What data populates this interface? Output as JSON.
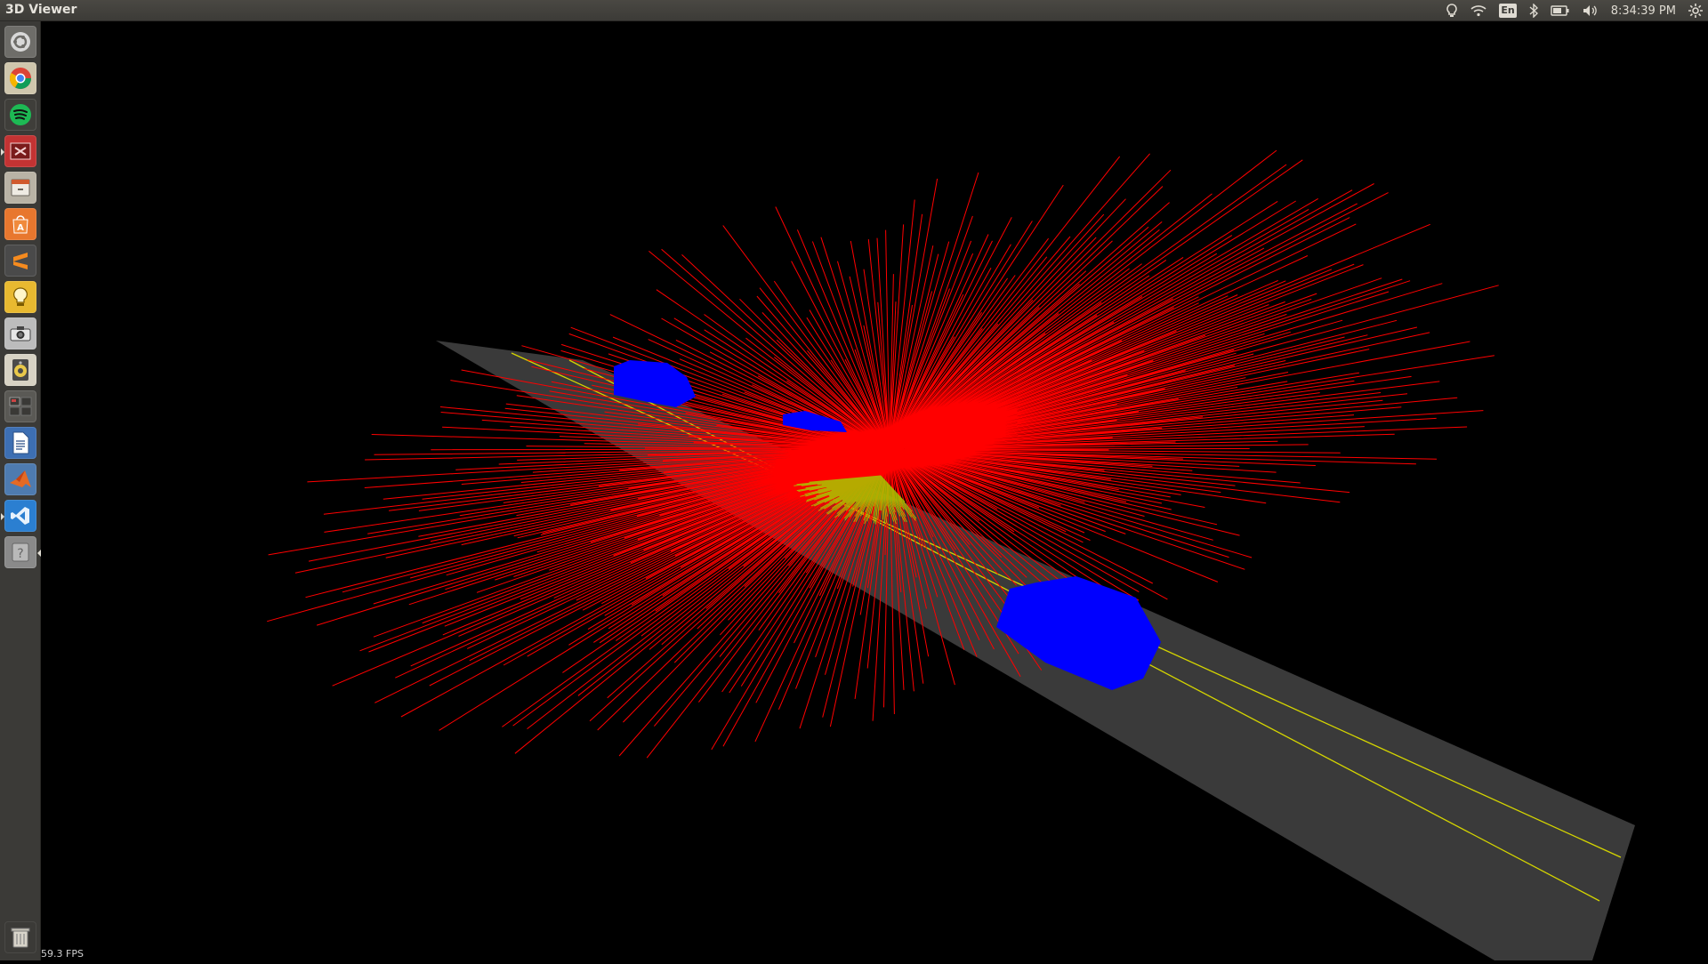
{
  "topbar": {
    "app_title": "3D Viewer",
    "keyboard_layout": "En",
    "clock": "8:34:39 PM",
    "indicators": [
      "notification-bulb-icon",
      "wifi-icon",
      "keyboard-layout-icon",
      "bluetooth-icon",
      "battery-icon",
      "volume-icon",
      "system-gear-icon"
    ]
  },
  "launcher": {
    "items": [
      {
        "name": "dash-home",
        "icon": "ubuntu-logo-icon",
        "color": "#9a9a9a"
      },
      {
        "name": "chrome",
        "icon": "chrome-icon",
        "color": "#d8d0b8"
      },
      {
        "name": "spotify",
        "icon": "spotify-icon",
        "color": "#1db954"
      },
      {
        "name": "terminal-app",
        "icon": "red-app-icon",
        "color": "#c33333"
      },
      {
        "name": "files",
        "icon": "file-cabinet-icon",
        "color": "#b9b3a6"
      },
      {
        "name": "software-center",
        "icon": "software-center-icon",
        "color": "#e8772e"
      },
      {
        "name": "sublime-text",
        "icon": "sublime-icon",
        "color": "#4a4a4a"
      },
      {
        "name": "notes",
        "icon": "lightbulb-icon",
        "color": "#e8b930"
      },
      {
        "name": "camera",
        "icon": "camera-icon",
        "color": "#bcbcbc"
      },
      {
        "name": "speaker",
        "icon": "speaker-icon",
        "color": "#d7d2c4"
      },
      {
        "name": "workspace-switcher",
        "icon": "workspaces-icon",
        "color": "#5a5955"
      },
      {
        "name": "writer",
        "icon": "document-icon",
        "color": "#3d6fb3"
      },
      {
        "name": "matlab",
        "icon": "matlab-icon",
        "color": "#4e7bb0"
      },
      {
        "name": "vscode",
        "icon": "vscode-icon",
        "color": "#2b7fd1"
      },
      {
        "name": "unknown-app",
        "icon": "question-icon",
        "color": "#8a8a8a"
      }
    ],
    "trash_icon": "trash-icon"
  },
  "scene": {
    "road_color": "#3a3a3a",
    "lane_line_color": "#d4d400",
    "lidar_ray_color": "#ff0000",
    "ground_hit_color": "#a8c800",
    "vehicle_color": "#0000ff",
    "background": "#000000"
  },
  "status": {
    "fps": "59.3 FPS"
  }
}
